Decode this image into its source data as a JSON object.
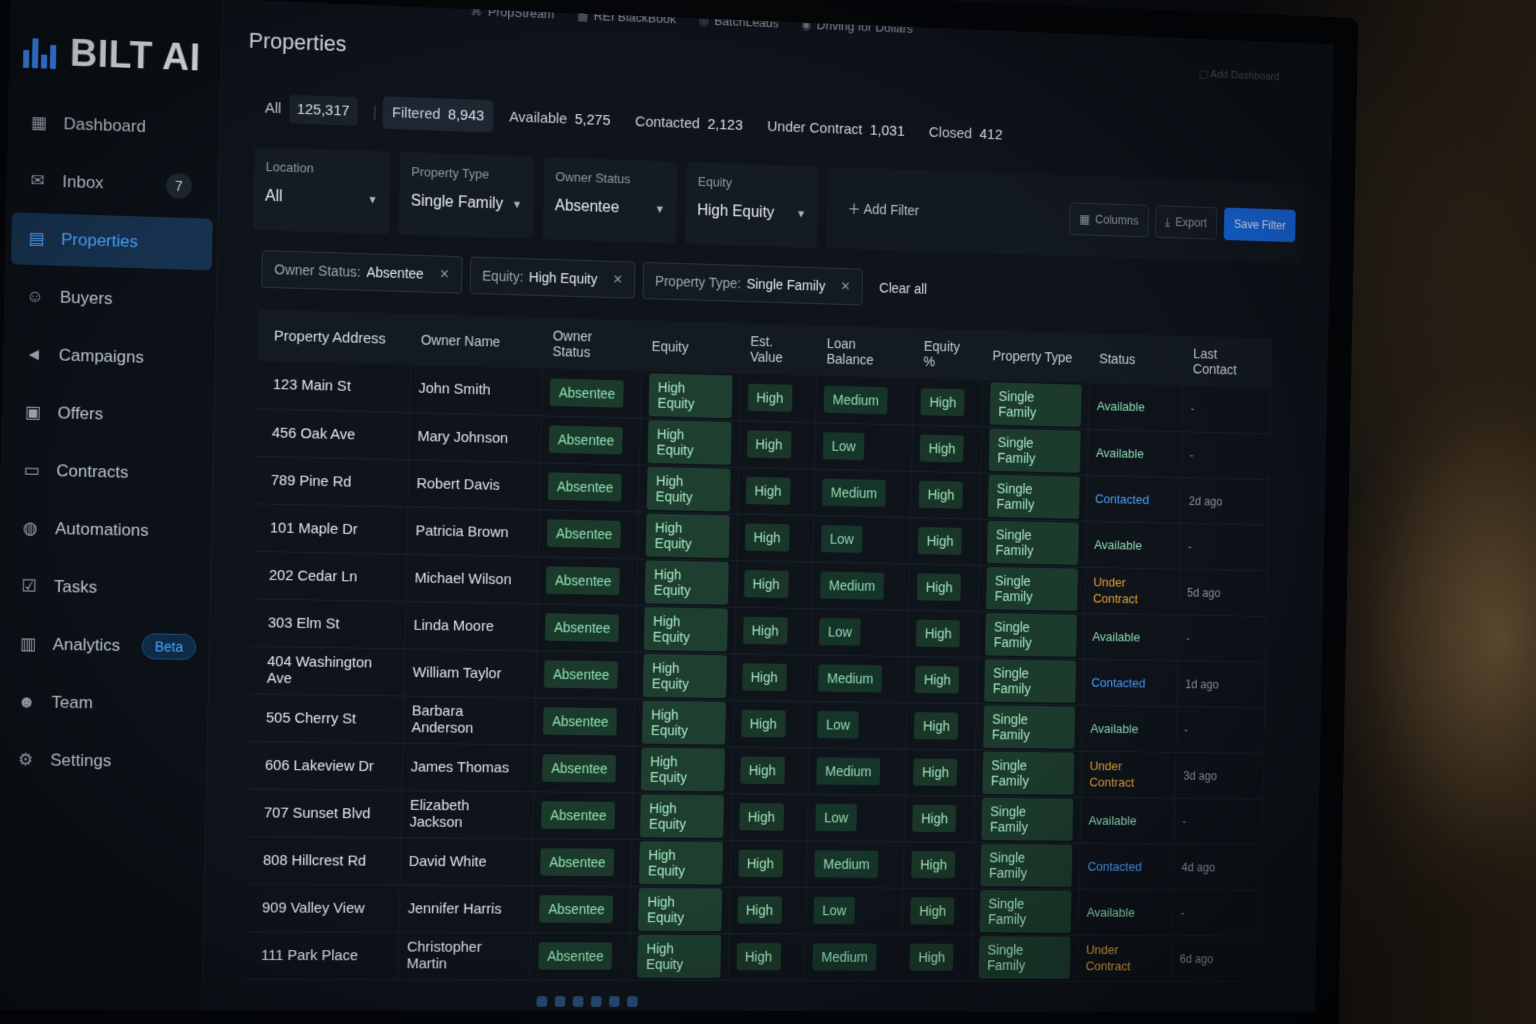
{
  "app": {
    "name": "BILT AI"
  },
  "topbar": {
    "integrations": [
      "PropStream",
      "REI BlackBook",
      "BatchLeads",
      "Driving for Dollars"
    ],
    "right_link": "Add Dashboard"
  },
  "sidebar": {
    "items": [
      {
        "label": "Dashboard",
        "icon": "dashboard-icon",
        "active": false
      },
      {
        "label": "Inbox",
        "icon": "inbox-icon",
        "badge": "7"
      },
      {
        "label": "Properties",
        "icon": "properties-icon",
        "active": true
      },
      {
        "label": "Buyers",
        "icon": "buyers-icon"
      },
      {
        "label": "Campaigns",
        "icon": "megaphone-icon"
      },
      {
        "label": "Offers",
        "icon": "offers-icon"
      },
      {
        "label": "Contracts",
        "icon": "contracts-icon"
      },
      {
        "label": "Automations",
        "icon": "automations-icon"
      },
      {
        "label": "Tasks",
        "icon": "tasks-icon"
      },
      {
        "label": "Analytics",
        "icon": "analytics-icon",
        "tag": "Beta"
      },
      {
        "label": "Team",
        "icon": "team-icon"
      },
      {
        "label": "Settings",
        "icon": "settings-icon"
      }
    ]
  },
  "page": {
    "title": "Properties"
  },
  "counts": [
    {
      "label": "All",
      "value": "125,317"
    },
    {
      "label": "Filtered",
      "value": "8,943"
    },
    {
      "label": "Available",
      "value": "5,275"
    },
    {
      "label": "Contacted",
      "value": "2,123"
    },
    {
      "label": "Under Contract",
      "value": "1,031"
    },
    {
      "label": "Closed",
      "value": "412"
    }
  ],
  "filters": [
    {
      "label": "Location",
      "value": "All"
    },
    {
      "label": "Property Type",
      "value": "Single Family"
    },
    {
      "label": "Owner Status",
      "value": "Absentee"
    },
    {
      "label": "Equity",
      "value": "High Equity"
    }
  ],
  "toolbar": {
    "add_filter": "Add Filter",
    "columns": "Columns",
    "export": "Export",
    "save_filter": "Save Filter"
  },
  "active_filters": [
    {
      "key": "Owner Status:",
      "value": "Absentee"
    },
    {
      "key": "Equity:",
      "value": "High Equity"
    },
    {
      "key": "Property Type:",
      "value": "Single Family"
    }
  ],
  "clear_all": "Clear all",
  "table": {
    "columns": [
      "Property Address",
      "Owner Name",
      "Owner Status",
      "Equity",
      "Est. Value",
      "Loan Balance",
      "Equity %",
      "Property Type",
      "Status",
      "Last Contact"
    ],
    "rows": [
      [
        "123 Main St",
        "John Smith",
        "Absentee",
        "High Equity",
        "High",
        "Medium",
        "High",
        "Single Family",
        "Available",
        "-"
      ],
      [
        "456 Oak Ave",
        "Mary Johnson",
        "Absentee",
        "High Equity",
        "High",
        "Low",
        "High",
        "Single Family",
        "Available",
        "-"
      ],
      [
        "789 Pine Rd",
        "Robert Davis",
        "Absentee",
        "High Equity",
        "High",
        "Medium",
        "High",
        "Single Family",
        "Contacted",
        "2d ago"
      ],
      [
        "101 Maple Dr",
        "Patricia Brown",
        "Absentee",
        "High Equity",
        "High",
        "Low",
        "High",
        "Single Family",
        "Available",
        "-"
      ],
      [
        "202 Cedar Ln",
        "Michael Wilson",
        "Absentee",
        "High Equity",
        "High",
        "Medium",
        "High",
        "Single Family",
        "Under Contract",
        "5d ago"
      ],
      [
        "303 Elm St",
        "Linda Moore",
        "Absentee",
        "High Equity",
        "High",
        "Low",
        "High",
        "Single Family",
        "Available",
        "-"
      ],
      [
        "404 Washington Ave",
        "William Taylor",
        "Absentee",
        "High Equity",
        "High",
        "Medium",
        "High",
        "Single Family",
        "Contacted",
        "1d ago"
      ],
      [
        "505 Cherry St",
        "Barbara Anderson",
        "Absentee",
        "High Equity",
        "High",
        "Low",
        "High",
        "Single Family",
        "Available",
        "-"
      ],
      [
        "606 Lakeview Dr",
        "James Thomas",
        "Absentee",
        "High Equity",
        "High",
        "Medium",
        "High",
        "Single Family",
        "Under Contract",
        "3d ago"
      ],
      [
        "707 Sunset Blvd",
        "Elizabeth Jackson",
        "Absentee",
        "High Equity",
        "High",
        "Low",
        "High",
        "Single Family",
        "Available",
        "-"
      ],
      [
        "808 Hillcrest Rd",
        "David White",
        "Absentee",
        "High Equity",
        "High",
        "Medium",
        "High",
        "Single Family",
        "Contacted",
        "4d ago"
      ],
      [
        "909 Valley View",
        "Jennifer Harris",
        "Absentee",
        "High Equity",
        "High",
        "Low",
        "High",
        "Single Family",
        "Available",
        "-"
      ],
      [
        "111 Park Place",
        "Christopher Martin",
        "Absentee",
        "High Equity",
        "High",
        "Medium",
        "High",
        "Single Family",
        "Under Contract",
        "6d ago"
      ]
    ]
  },
  "colors": {
    "accent": "#3d8bff",
    "available": "#8bdcb0",
    "contacted": "#4a9dff",
    "under_contract": "#e0a13a",
    "pill_bg": "#1b3a2c"
  }
}
